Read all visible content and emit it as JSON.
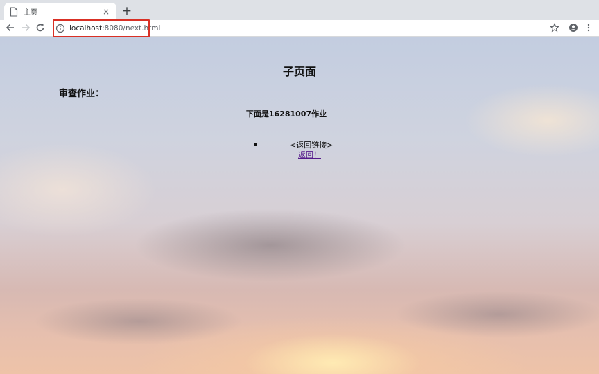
{
  "tab": {
    "title": "主页",
    "icon": "document-icon",
    "close_glyph": "×"
  },
  "new_tab_glyph": "+",
  "toolbar": {
    "url_host": "localhost",
    "url_rest": ":8080/next.html",
    "highlight_color": "#d93025"
  },
  "page": {
    "title": "子页面",
    "section_heading": "审查作业：",
    "subheading": "下面是16281007作业",
    "link_label": "<返回链接>",
    "back_link_text": "返回！"
  },
  "colors": {
    "visited_link": "#551a8b",
    "chrome_frame": "#dee1e6"
  }
}
